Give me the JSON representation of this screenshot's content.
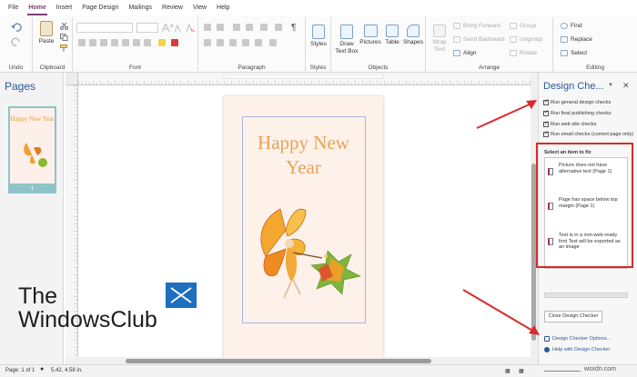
{
  "ribbon": {
    "tabs": [
      "File",
      "Home",
      "Insert",
      "Page Design",
      "Mailings",
      "Review",
      "View",
      "Help"
    ],
    "active_tab": "Home",
    "groups": {
      "undo": "Undo",
      "clipboard": "Clipboard",
      "font": "Font",
      "paragraph": "Paragraph",
      "styles": "Styles",
      "objects": "Objects",
      "arrange": "Arrange",
      "editing": "Editing"
    },
    "buttons": {
      "paste": "Paste",
      "styles": "Styles",
      "draw_text_box": "Draw Text Box",
      "pictures": "Pictures",
      "table": "Table",
      "shapes": "Shapes",
      "wrap_text": "Wrap Text",
      "bring_forward": "Bring Forward",
      "send_backward": "Send Backward",
      "align": "Align",
      "group": "Group",
      "ungroup": "Ungroup",
      "rotate": "Rotate",
      "find": "Find",
      "replace": "Replace",
      "select": "Select"
    }
  },
  "pages_pane": {
    "title": "Pages",
    "thumb_text": "Happy New Year",
    "page_number": "1"
  },
  "document": {
    "headline_line1": "Happy New",
    "headline_line2": "Year"
  },
  "design_checker": {
    "title": "Design Che...",
    "checks": [
      "Run general design checks",
      "Run final publishing checks",
      "Run web site checks",
      "Run email checks (current page only)"
    ],
    "select_label": "Select an item to fix",
    "items": [
      "Picture does not have alternative text (Page 1)",
      "Page has space below top margin (Page 1)",
      "Text is in a non-web-ready font Text will be exported as an image"
    ],
    "close_button": "Close Design Checker",
    "options_link": "Design Checker Options...",
    "help_link": "Help with Design Checker"
  },
  "status_bar": {
    "page": "Page: 1 of 1",
    "position": "5.42, 4.58 in."
  },
  "watermark": {
    "line1": "The",
    "line2": "WindowsClub",
    "site": "wsxdn.com"
  },
  "colors": {
    "accent": "#7a3f78",
    "pane_title": "#2b579a",
    "headline": "#e8a35a",
    "annotation_red": "#d82b2b"
  }
}
